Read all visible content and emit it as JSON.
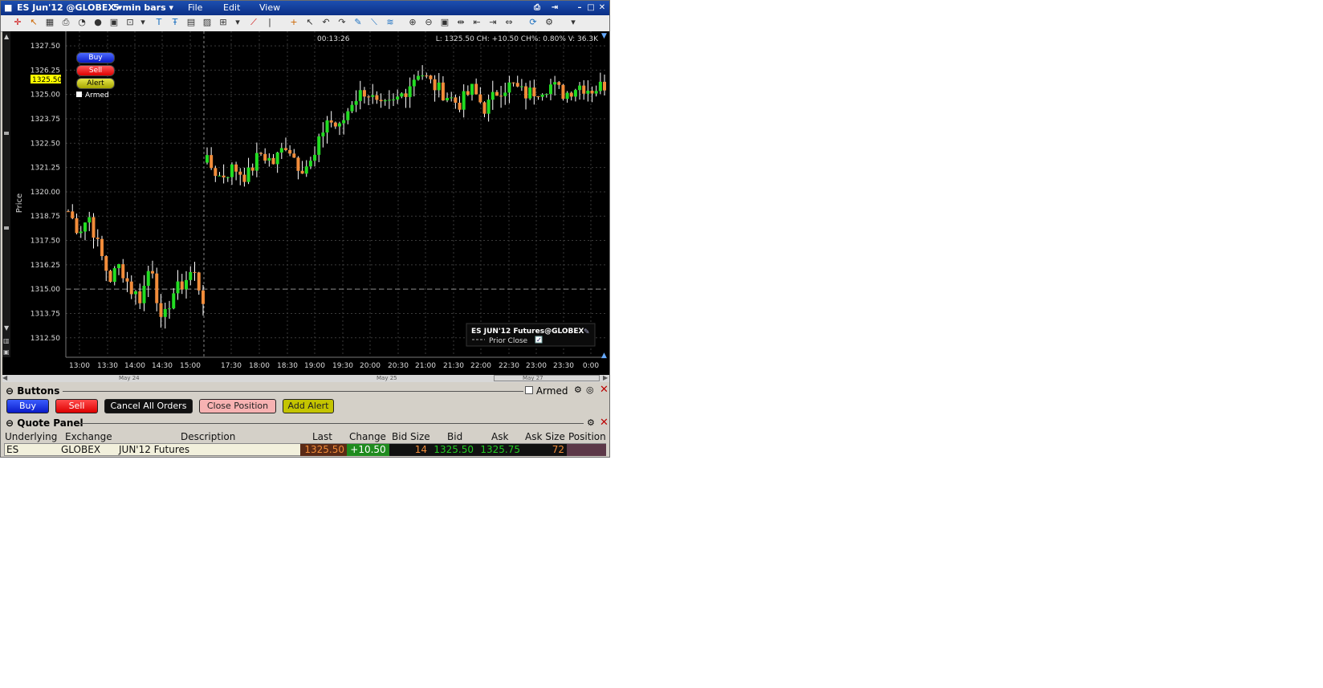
{
  "title_bar": {
    "instrument": "ES Jun'12 @GLOBEX",
    "bar_size": "5 min bars",
    "menu": [
      "File",
      "Edit",
      "View"
    ]
  },
  "chart": {
    "readout_time": "00:13:26",
    "readout_stats": "L: 1325.50  CH: +10.50  CH%: 0.80%  V: 36.3K",
    "y_axis_label": "Price",
    "current_price_tag": "1325.50",
    "order_buttons": {
      "buy": "Buy",
      "sell": "Sell",
      "alert": "Alert",
      "armed": "Armed"
    },
    "legend": {
      "title": "ES JUN'12 Futures@GLOBEX",
      "prior_close": "Prior Close"
    },
    "date_labels": [
      "May 24",
      "May 25",
      "May 27"
    ],
    "colors": {
      "up": "#22dd22",
      "down": "#f28c3a",
      "grid": "#3a3a3a",
      "price_tag": "#ffff00"
    }
  },
  "chart_data": {
    "type": "candlestick",
    "ylabel": "Price",
    "ylim": [
      1311.5,
      1328.0
    ],
    "y_ticks": [
      "1327.50",
      "1326.25",
      "1325.00",
      "1323.75",
      "1322.50",
      "1321.25",
      "1320.00",
      "1318.75",
      "1317.50",
      "1316.25",
      "1315.00",
      "1313.75",
      "1312.50"
    ],
    "x_ticks": [
      "13:00",
      "13:30",
      "14:00",
      "14:30",
      "15:00",
      "17:30",
      "18:00",
      "18:30",
      "19:00",
      "19:30",
      "20:00",
      "20:30",
      "21:00",
      "21:30",
      "22:00",
      "22:30",
      "23:00",
      "23:30",
      "0:00"
    ],
    "prior_close": 1315.0,
    "last": 1325.5,
    "close_path": [
      1319.0,
      1318.0,
      1318.75,
      1317.0,
      1315.5,
      1316.25,
      1315.0,
      1314.5,
      1316.5,
      1313.0,
      1314.75,
      1315.25,
      1316.0,
      1314.5,
      1321.5,
      1320.75,
      1321.25,
      1320.75,
      1322.0,
      1321.5,
      1322.5,
      1321.25,
      1321.5,
      1323.75,
      1323.25,
      1324.75,
      1325.25,
      1324.25,
      1324.5,
      1325.25,
      1326.25,
      1325.5,
      1325.0,
      1324.5,
      1325.25,
      1324.25,
      1325.25,
      1325.5,
      1325.0,
      1325.25,
      1325.5,
      1325.0,
      1325.5,
      1325.25,
      1325.5
    ]
  },
  "nav_strip": {
    "dates": [
      "May 24",
      "May 25",
      "May 27"
    ]
  },
  "buttons_panel": {
    "title": "Buttons",
    "armed": "Armed",
    "buy": "Buy",
    "sell": "Sell",
    "cancel_all": "Cancel All Orders",
    "close_position": "Close Position",
    "add_alert": "Add Alert"
  },
  "quote_panel": {
    "title": "Quote Panel",
    "columns": [
      "Underlying",
      "Exchange",
      "Description",
      "Last",
      "Change",
      "Bid Size",
      "Bid",
      "Ask",
      "Ask Size",
      "Position"
    ],
    "row": {
      "underlying": "ES",
      "exchange": "GLOBEX",
      "description": "JUN'12 Futures",
      "last": "1325.50",
      "change": "+10.50",
      "bid_size": "14",
      "bid": "1325.50",
      "ask": "1325.75",
      "ask_size": "72",
      "position": ""
    }
  }
}
